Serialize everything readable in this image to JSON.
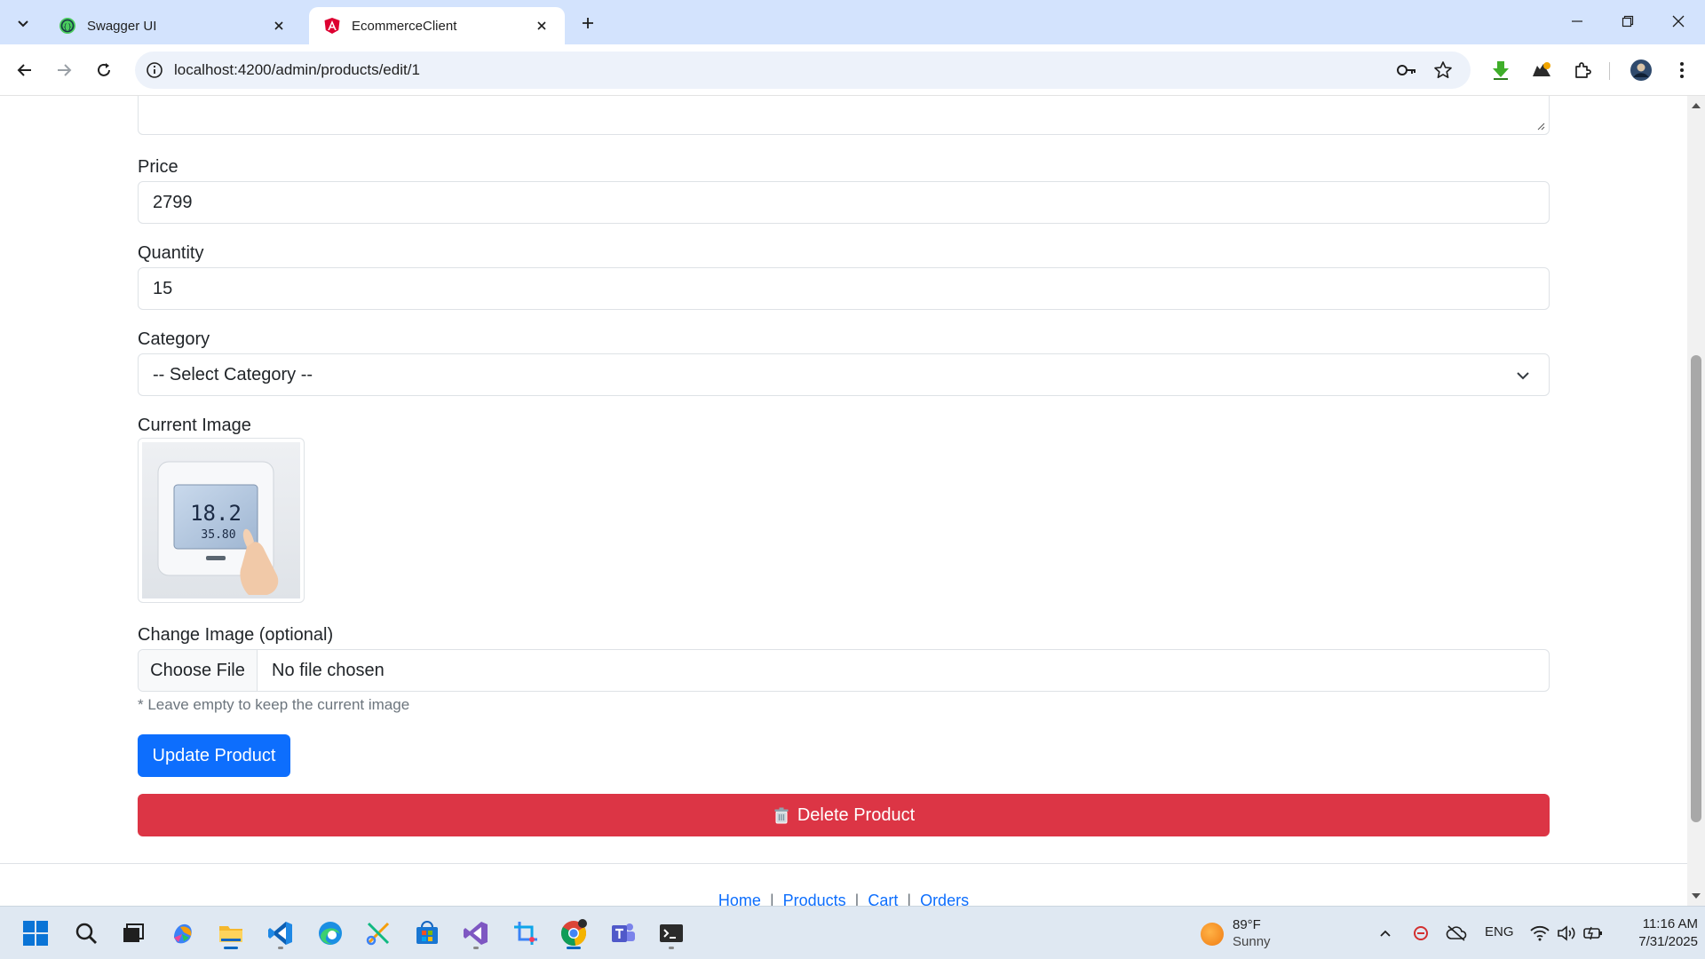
{
  "browser": {
    "tabs": [
      {
        "title": "Swagger UI",
        "active": false
      },
      {
        "title": "EcommerceClient",
        "active": true
      }
    ],
    "url": "localhost:4200/admin/products/edit/1"
  },
  "form": {
    "price_label": "Price",
    "price_value": "2799",
    "quantity_label": "Quantity",
    "quantity_value": "15",
    "category_label": "Category",
    "category_selected": "-- Select Category --",
    "current_image_label": "Current Image",
    "thermostat_reading_temp": "18.2",
    "thermostat_reading_hum": "35.80",
    "change_image_label": "Change Image (optional)",
    "choose_file_label": "Choose File",
    "file_status": "No file chosen",
    "hint": "* Leave empty to keep the current image",
    "update_button": "Update Product",
    "delete_button": "Delete Product"
  },
  "footer": {
    "links": [
      "Home",
      "Products",
      "Cart",
      "Orders"
    ]
  },
  "taskbar": {
    "weather_temp": "89°F",
    "weather_condition": "Sunny",
    "language": "ENG",
    "time": "11:16 AM",
    "date": "7/31/2025"
  },
  "colors": {
    "primary": "#0d6efd",
    "danger": "#dc3545",
    "tabbar": "#d3e3fd"
  }
}
